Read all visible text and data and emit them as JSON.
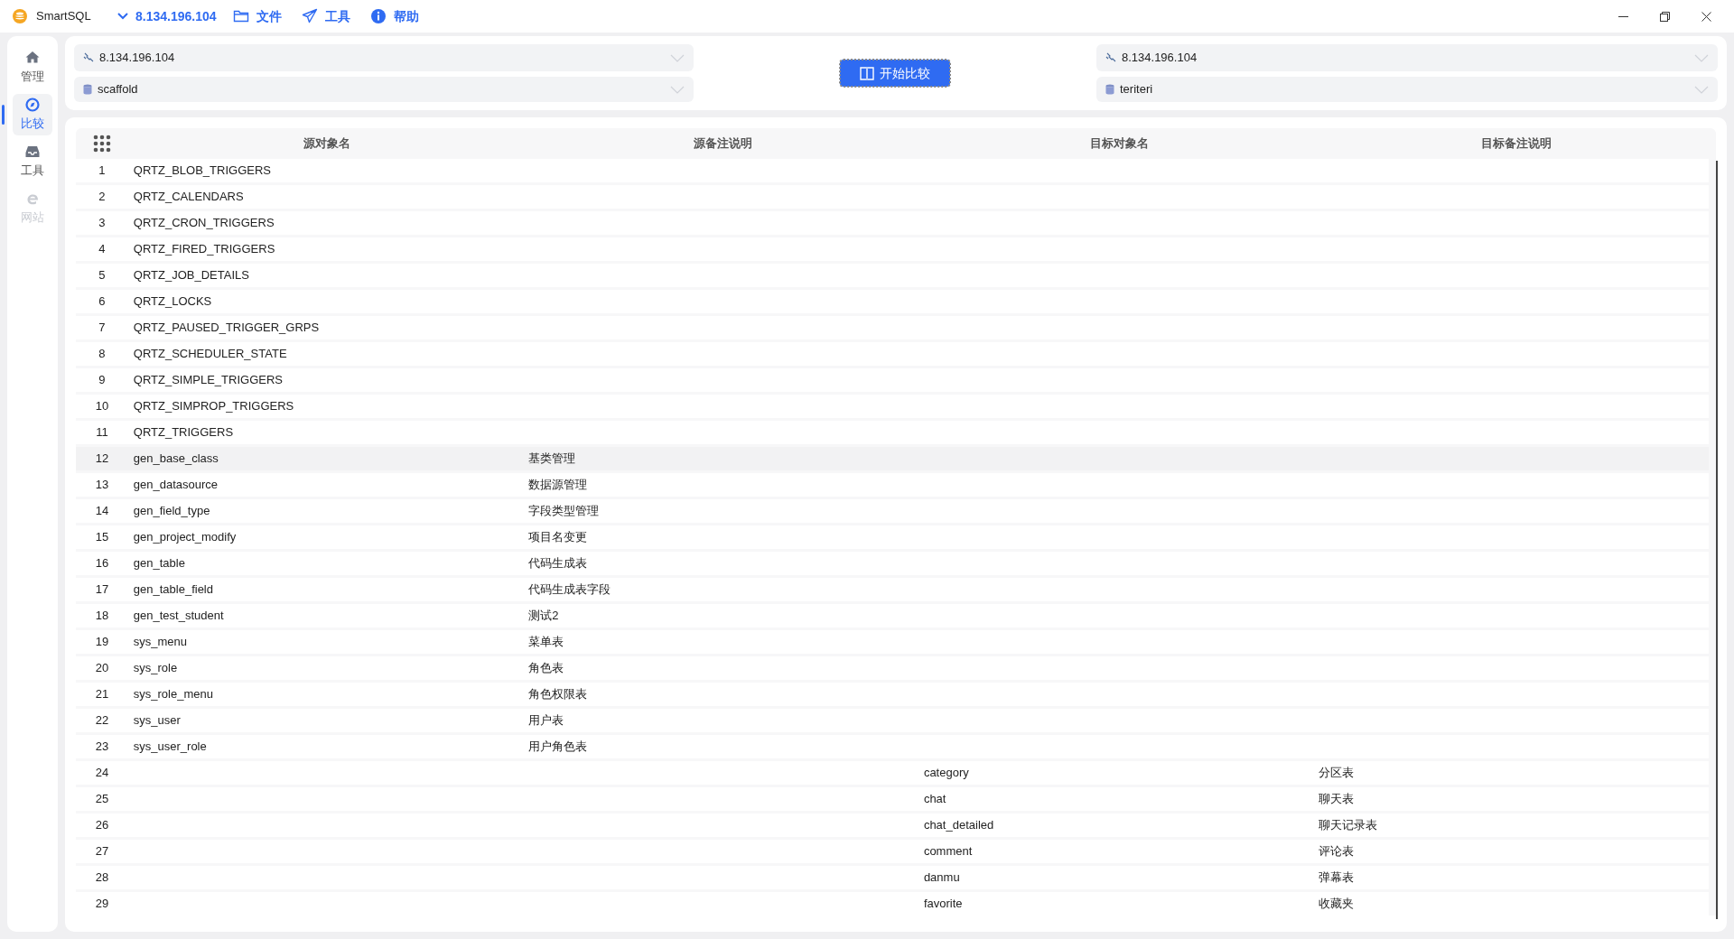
{
  "app": {
    "title": "SmartSQL",
    "connection": "8.134.196.104",
    "menu": [
      {
        "label": "文件",
        "kind": "folder"
      },
      {
        "label": "工具",
        "kind": "send"
      },
      {
        "label": "帮助",
        "kind": "info"
      }
    ]
  },
  "sidebar": [
    {
      "label": "管理",
      "kind": "home",
      "selected": false,
      "disabled": false
    },
    {
      "label": "比较",
      "kind": "compass",
      "selected": true,
      "disabled": false
    },
    {
      "label": "工具",
      "kind": "inbox",
      "selected": false,
      "disabled": false
    },
    {
      "label": "网站",
      "kind": "web",
      "selected": false,
      "disabled": true
    }
  ],
  "source": {
    "connection": "8.134.196.104",
    "database": "scaffold"
  },
  "compare_button": "开始比较",
  "target": {
    "connection": "8.134.196.104",
    "database": "teriteri"
  },
  "table": {
    "columns": [
      "源对象名",
      "源备注说明",
      "目标对象名",
      "目标备注说明"
    ],
    "rows": [
      {
        "index": "1",
        "source_name": "QRTZ_BLOB_TRIGGERS",
        "selected": false
      },
      {
        "index": "2",
        "source_name": "QRTZ_CALENDARS",
        "selected": false
      },
      {
        "index": "3",
        "source_name": "QRTZ_CRON_TRIGGERS",
        "selected": false
      },
      {
        "index": "4",
        "source_name": "QRTZ_FIRED_TRIGGERS",
        "selected": false
      },
      {
        "index": "5",
        "source_name": "QRTZ_JOB_DETAILS",
        "selected": false
      },
      {
        "index": "6",
        "source_name": "QRTZ_LOCKS",
        "selected": false
      },
      {
        "index": "7",
        "source_name": "QRTZ_PAUSED_TRIGGER_GRPS",
        "selected": false
      },
      {
        "index": "8",
        "source_name": "QRTZ_SCHEDULER_STATE",
        "selected": false
      },
      {
        "index": "9",
        "source_name": "QRTZ_SIMPLE_TRIGGERS",
        "selected": false
      },
      {
        "index": "10",
        "source_name": "QRTZ_SIMPROP_TRIGGERS",
        "selected": false
      },
      {
        "index": "11",
        "source_name": "QRTZ_TRIGGERS",
        "selected": false
      },
      {
        "index": "12",
        "source_name": "gen_base_class",
        "source_remark": "基类管理",
        "selected": true
      },
      {
        "index": "13",
        "source_name": "gen_datasource",
        "source_remark": "数据源管理",
        "selected": false
      },
      {
        "index": "14",
        "source_name": "gen_field_type",
        "source_remark": "字段类型管理",
        "selected": false
      },
      {
        "index": "15",
        "source_name": "gen_project_modify",
        "source_remark": "项目名变更",
        "selected": false
      },
      {
        "index": "16",
        "source_name": "gen_table",
        "source_remark": "代码生成表",
        "selected": false
      },
      {
        "index": "17",
        "source_name": "gen_table_field",
        "source_remark": "代码生成表字段",
        "selected": false
      },
      {
        "index": "18",
        "source_name": "gen_test_student",
        "source_remark": "测试2",
        "selected": false
      },
      {
        "index": "19",
        "source_name": "sys_menu",
        "source_remark": "菜单表",
        "selected": false
      },
      {
        "index": "20",
        "source_name": "sys_role",
        "source_remark": "角色表",
        "selected": false
      },
      {
        "index": "21",
        "source_name": "sys_role_menu",
        "source_remark": "角色权限表",
        "selected": false
      },
      {
        "index": "22",
        "source_name": "sys_user",
        "source_remark": "用户表",
        "selected": false
      },
      {
        "index": "23",
        "source_name": "sys_user_role",
        "source_remark": "用户角色表",
        "selected": false
      },
      {
        "index": "24",
        "target_name": "category",
        "target_remark": "分区表",
        "selected": false
      },
      {
        "index": "25",
        "target_name": "chat",
        "target_remark": "聊天表",
        "selected": false
      },
      {
        "index": "26",
        "target_name": "chat_detailed",
        "target_remark": "聊天记录表",
        "selected": false
      },
      {
        "index": "27",
        "target_name": "comment",
        "target_remark": "评论表",
        "selected": false
      },
      {
        "index": "28",
        "target_name": "danmu",
        "target_remark": "弹幕表",
        "selected": false
      },
      {
        "index": "29",
        "target_name": "favorite",
        "target_remark": "收藏夹",
        "selected": false
      }
    ]
  }
}
